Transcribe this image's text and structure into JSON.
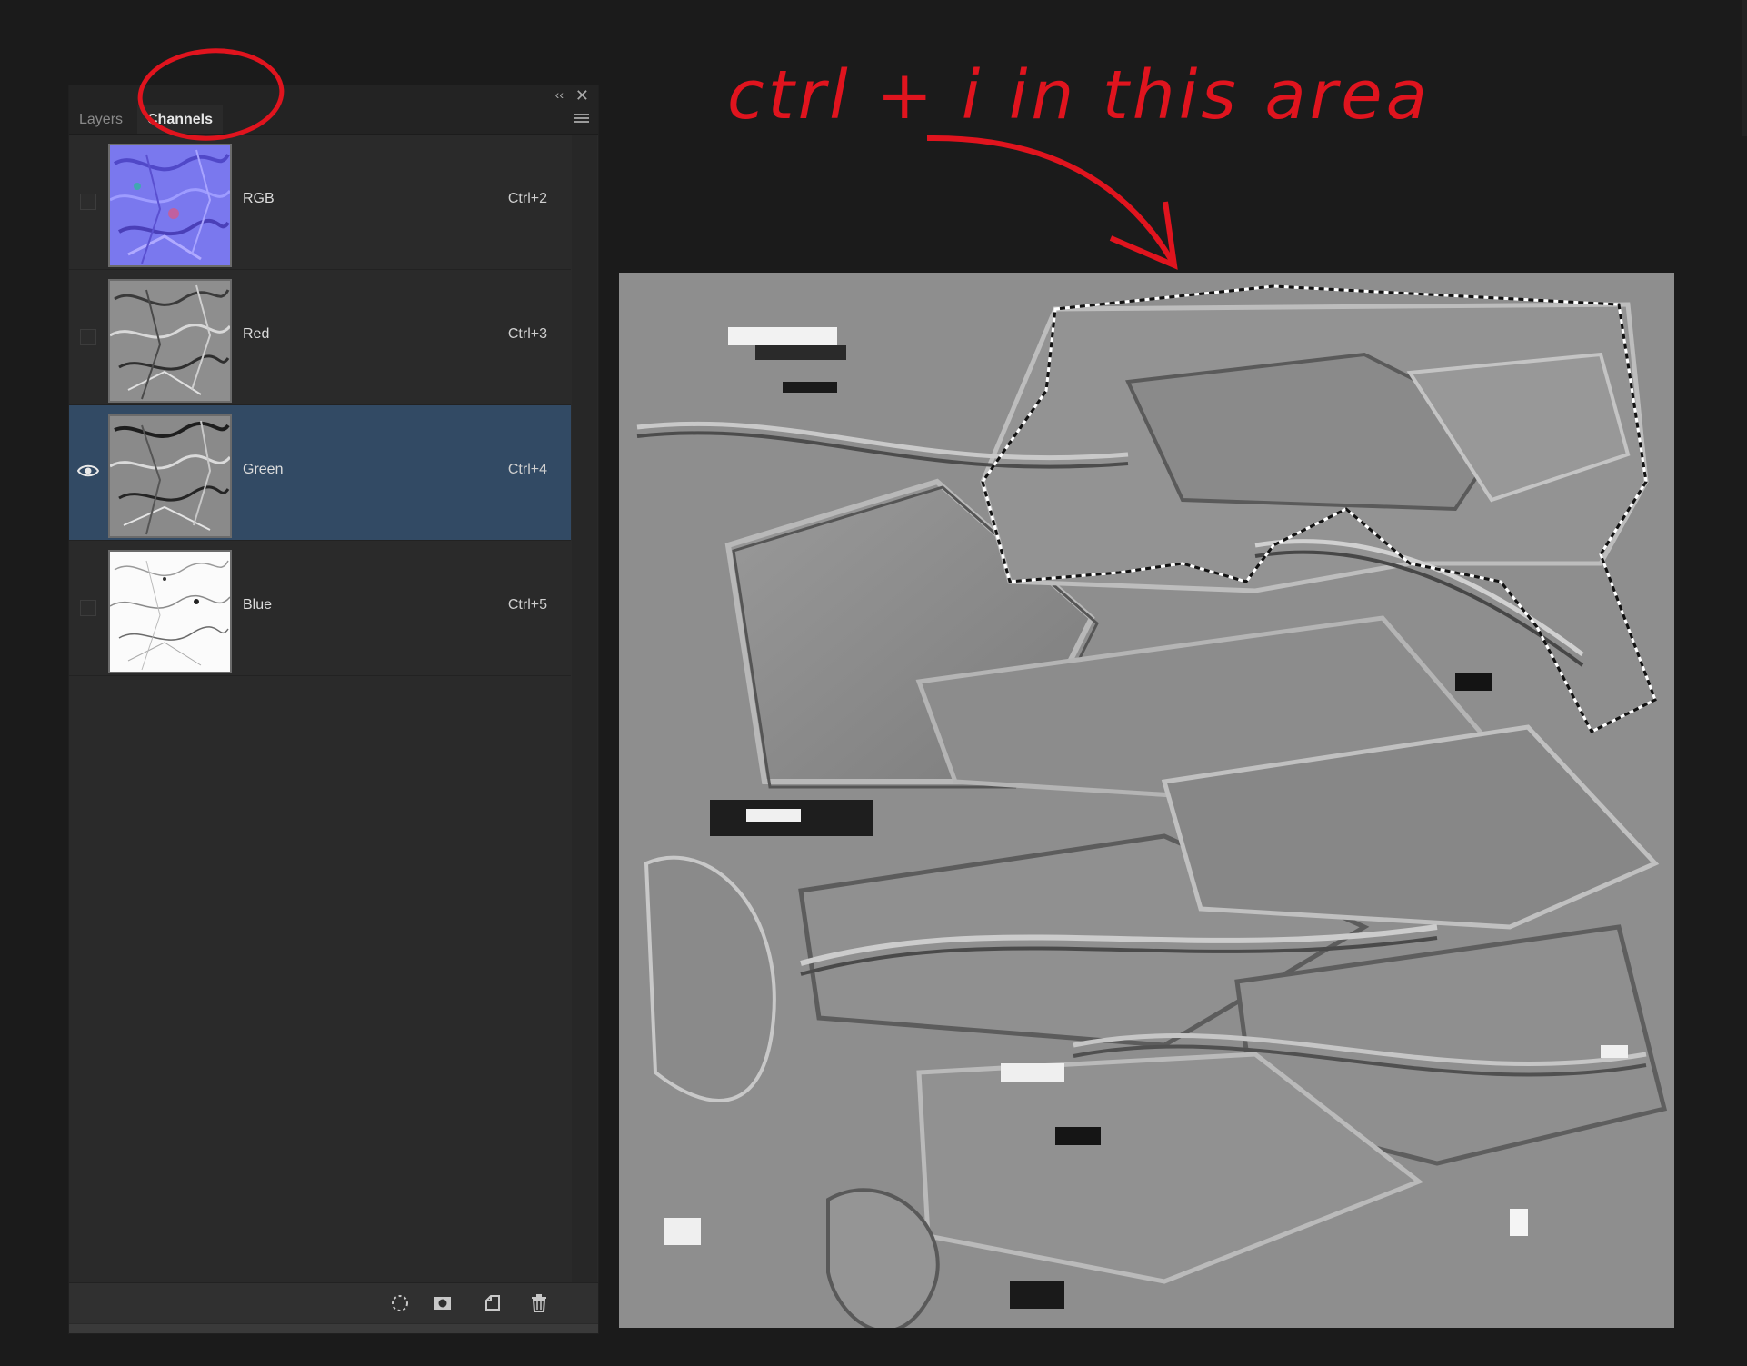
{
  "panel": {
    "collapse_icon": "double-chevron-left-icon",
    "close_icon": "close-icon",
    "tabs": [
      {
        "label": "Layers",
        "active": false
      },
      {
        "label": "Channels",
        "active": true
      }
    ],
    "menu_icon": "hamburger-menu-icon",
    "channels": [
      {
        "name": "RGB",
        "shortcut": "Ctrl+2",
        "visible": false,
        "selected": false
      },
      {
        "name": "Red",
        "shortcut": "Ctrl+3",
        "visible": false,
        "selected": false
      },
      {
        "name": "Green",
        "shortcut": "Ctrl+4",
        "visible": true,
        "selected": true
      },
      {
        "name": "Blue",
        "shortcut": "Ctrl+5",
        "visible": false,
        "selected": false
      }
    ],
    "footer_icons": [
      "dotted-selection-icon",
      "save-selection-icon",
      "new-channel-icon",
      "trash-icon"
    ]
  },
  "annotation": {
    "text": "ctrl + i  in this area",
    "color": "#e0141e"
  },
  "colors": {
    "selected_row": "#324a64",
    "annotation_red": "#e0141e"
  }
}
